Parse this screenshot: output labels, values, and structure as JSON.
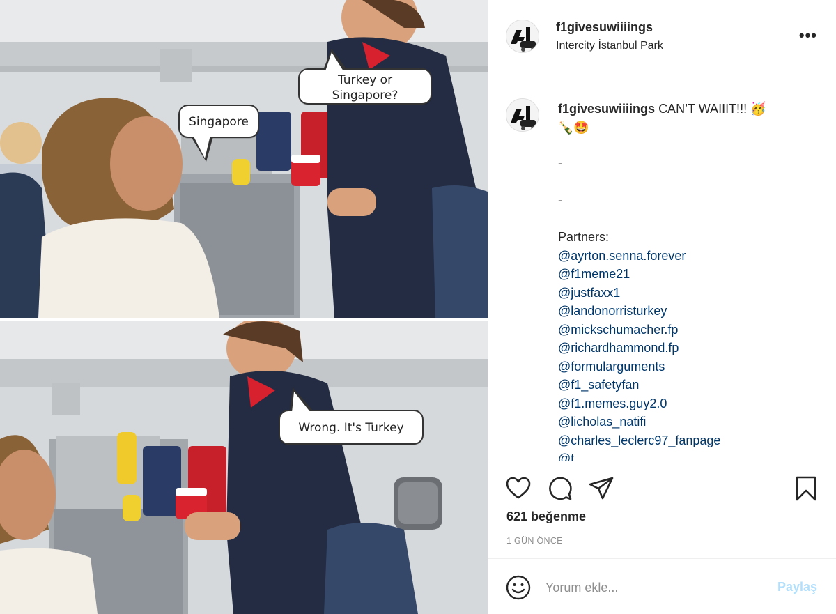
{
  "post": {
    "username": "f1givesuwiiiings",
    "location": "Intercity İstanbul Park",
    "more_icon": "more-options-icon"
  },
  "meme": {
    "bubble_question": "Turkey or\nSingapore?",
    "bubble_answer": "Singapore",
    "bubble_correction": "Wrong. It's Turkey"
  },
  "caption": {
    "username": "f1givesuwiiiings",
    "text": "CAN’T WAIIIT!!! 🥳",
    "emojis": "🍾🤩",
    "dash_1": "-",
    "dash_2": "-",
    "partners_label": "Partners:",
    "mentions": [
      "@ayrton.senna.forever",
      "@f1meme21",
      "@justfaxx1",
      "@landonorristurkey",
      "@mickschumacher.fp",
      "@richardhammond.fp",
      "@formularguments",
      "@f1_safetyfan",
      "@f1.memes.guy2.0",
      "@licholas_natifi",
      "@charles_leclerc97_fanpage",
      "@t"
    ]
  },
  "actions": {
    "icons": [
      "heart-icon",
      "comment-icon",
      "share-icon",
      "bookmark-icon"
    ],
    "likes": "621 beğenme",
    "timestamp": "1 GÜN ÖNCE"
  },
  "add_comment": {
    "placeholder": "Yorum ekle...",
    "post_label": "Paylaş"
  },
  "colors": {
    "mention": "#00376b",
    "post_button_disabled": "#b2dffc",
    "timestamp": "#8e8e8e"
  }
}
